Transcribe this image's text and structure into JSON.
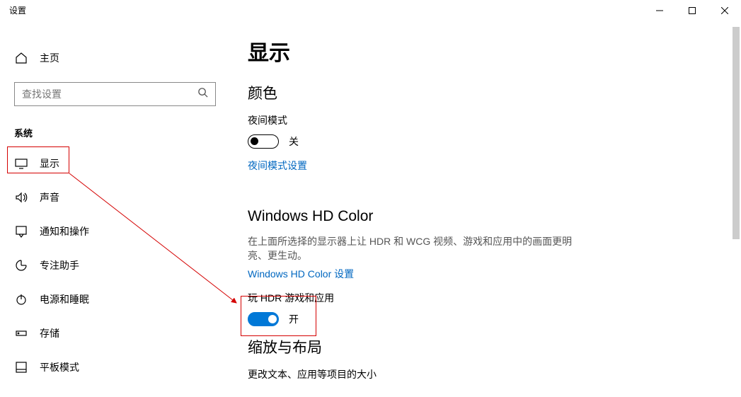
{
  "window": {
    "title": "设置"
  },
  "sidebar": {
    "home": "主页",
    "search_placeholder": "查找设置",
    "group": "系统",
    "items": [
      {
        "label": "显示"
      },
      {
        "label": "声音"
      },
      {
        "label": "通知和操作"
      },
      {
        "label": "专注助手"
      },
      {
        "label": "电源和睡眠"
      },
      {
        "label": "存储"
      },
      {
        "label": "平板模式"
      }
    ]
  },
  "page": {
    "title": "显示",
    "sections": {
      "color": {
        "heading": "颜色",
        "night_mode_label": "夜间模式",
        "night_mode_state": "关",
        "night_mode_link": "夜间模式设置"
      },
      "hdcolor": {
        "heading": "Windows HD Color",
        "desc": "在上面所选择的显示器上让 HDR 和 WCG 视频、游戏和应用中的画面更明亮、更生动。",
        "link": "Windows HD Color 设置",
        "hdr_label": "玩 HDR 游戏和应用",
        "hdr_state": "开"
      },
      "scale": {
        "heading": "缩放与布局",
        "desc": "更改文本、应用等项目的大小"
      }
    }
  }
}
